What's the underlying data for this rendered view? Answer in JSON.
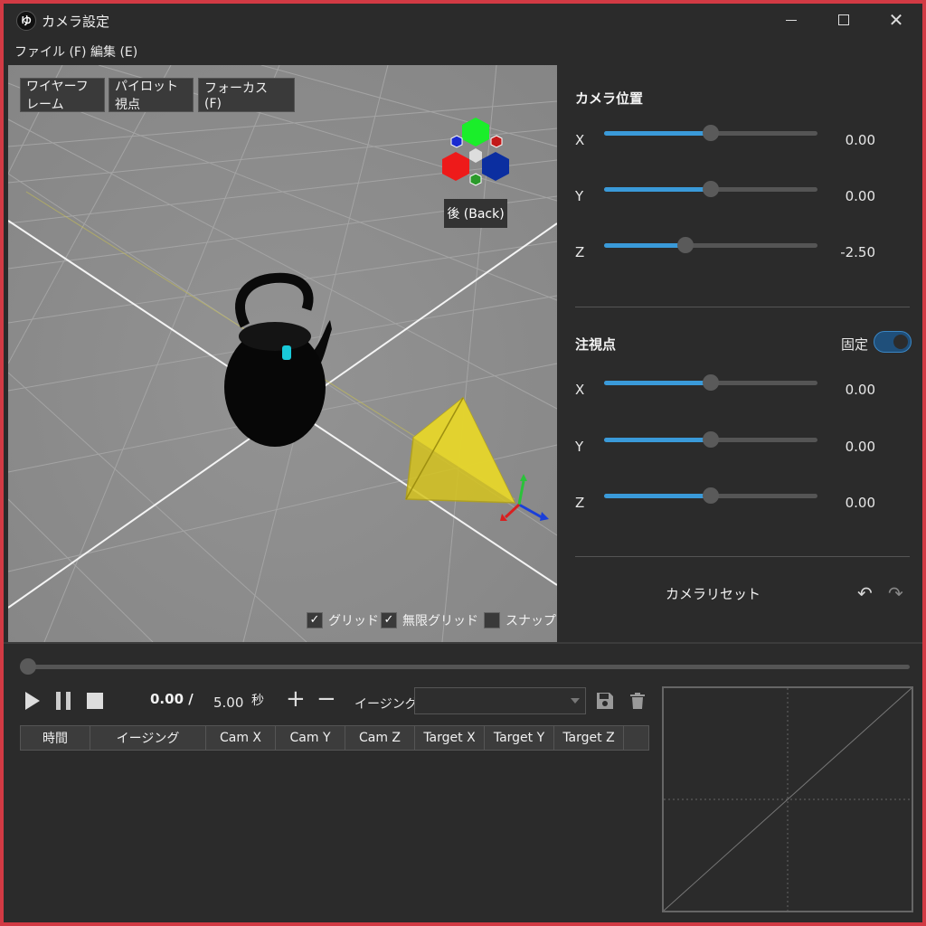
{
  "window": {
    "title": "カメラ設定",
    "app_icon_glyph": "ゆ"
  },
  "menu": {
    "items": [
      "ファイル (F)",
      "編集 (E)"
    ]
  },
  "viewport": {
    "buttons": {
      "wireframe": "ワイヤーフレーム",
      "pilot": "パイロット視点",
      "focus": "フォーカス (F)"
    },
    "gizmo_label": "後 (Back)",
    "checks": {
      "grid": {
        "label": "グリッド",
        "checked": true
      },
      "infinite_grid": {
        "label": "無限グリッド",
        "checked": true
      },
      "snap": {
        "label": "スナップ",
        "checked": false
      }
    },
    "background_color": "#8c8c8c"
  },
  "camera_position": {
    "title": "カメラ位置",
    "x": {
      "label": "X",
      "value": "0.00",
      "fraction": 0.5
    },
    "y": {
      "label": "Y",
      "value": "0.00",
      "fraction": 0.5
    },
    "z": {
      "label": "Z",
      "value": "-2.50",
      "fraction": 0.38
    }
  },
  "target": {
    "title": "注視点",
    "lock_label": "固定",
    "lock_on": true,
    "x": {
      "label": "X",
      "value": "0.00",
      "fraction": 0.5
    },
    "y": {
      "label": "Y",
      "value": "0.00",
      "fraction": 0.5
    },
    "z": {
      "label": "Z",
      "value": "0.00",
      "fraction": 0.5
    }
  },
  "actions": {
    "reset": "カメラリセット"
  },
  "playback": {
    "current_time": "0.00 /",
    "total_time": "5.00",
    "unit": "秒",
    "easing_label": "イージング",
    "easing_value": "",
    "timeline_fraction": 0
  },
  "keyframes": {
    "columns": [
      "時間",
      "イージング",
      "Cam X",
      "Cam Y",
      "Cam Z",
      "Target X",
      "Target Y",
      "Target Z",
      ""
    ],
    "rows": []
  },
  "colors": {
    "accent": "#3a9ad9",
    "window_border": "#d23a44",
    "camera_frustum": "#d6c41e"
  }
}
